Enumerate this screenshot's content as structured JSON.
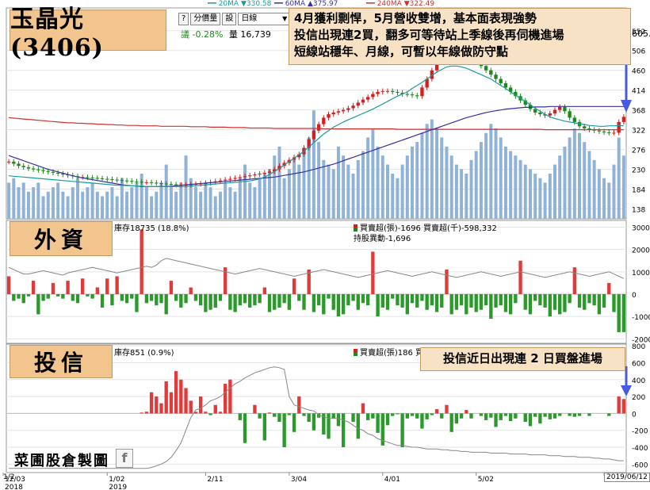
{
  "title": "玉晶光(3406)",
  "toolbar": {
    "analysis_btn": "分價量",
    "settings_btn": "設",
    "period_select": "日線"
  },
  "ma_legend": [
    {
      "label": "20MA",
      "arrow": "▼",
      "value": "330.58",
      "color": "#1a9c9c"
    },
    {
      "label": "60MA",
      "arrow": "▲",
      "value": "375.97",
      "color": "#3b2fa0"
    },
    {
      "label": "240MA",
      "arrow": "▼",
      "value": "322.49",
      "color": "#d03030"
    }
  ],
  "price_info": {
    "fragment": "議",
    "change": "-0.28%",
    "volume_label": "量",
    "volume": "16,739"
  },
  "price_top_label": "605.",
  "note_price": [
    "4月獲利剽悍，5月營收雙增，基本面表現強勢",
    "投信出現連2買，翻多可等待站上季線後再伺機進場",
    "短線站穩年、月線，可暫以年線做防守點"
  ],
  "panel_foreign": {
    "tag": "外資",
    "hold": "庫存18735 (18.8%)",
    "buysell": "買賣超(張)-1696 買賣超(千)-598,332",
    "change": "持股異動-1,696"
  },
  "panel_trust": {
    "tag": "投信",
    "hold": "庫存851 (0.9%)",
    "buysell": "買賣超(張)186 買賣",
    "note": "投信近日出現連 2 日買盤進場"
  },
  "watermark": "菜圃股倉製圖",
  "fb_icon": "facebook-icon",
  "date_labels": [
    {
      "text": "12/03",
      "sub": "2018"
    },
    {
      "text": "1/02",
      "sub": "2019"
    },
    {
      "text": "2/11",
      "sub": ""
    },
    {
      "text": "3/04",
      "sub": ""
    },
    {
      "text": "4/01",
      "sub": ""
    },
    {
      "text": "5/02",
      "sub": ""
    },
    {
      "text": "6/03",
      "sub": ""
    }
  ],
  "date_overlay": "1/2",
  "last_date": "2019/06/12",
  "chart_data": [
    {
      "type": "candlestick",
      "title": "玉晶光(3406)",
      "ylim": [
        115,
        605
      ],
      "y_ticks": [
        138,
        184,
        230,
        276,
        322,
        368,
        414,
        460,
        506,
        552
      ],
      "x_dates": [
        "12/03",
        "1/02",
        "2/11",
        "3/04",
        "4/01",
        "5/02",
        "6/03"
      ],
      "close": [
        248,
        243,
        238,
        235,
        232,
        230,
        228,
        226,
        224,
        222,
        220,
        218,
        216,
        214,
        212,
        212,
        211,
        210,
        209,
        208,
        207,
        206,
        205,
        204,
        203,
        202,
        201,
        200,
        200,
        199,
        198,
        197,
        196,
        195,
        194,
        194,
        194,
        195,
        196,
        197,
        198,
        200,
        202,
        204,
        206,
        208,
        210,
        212,
        214,
        216,
        218,
        220,
        222,
        225,
        230,
        238,
        245,
        252,
        258,
        265,
        280,
        300,
        320,
        335,
        350,
        358,
        362,
        365,
        368,
        372,
        378,
        385,
        392,
        398,
        405,
        410,
        412,
        412,
        410,
        408,
        405,
        404,
        402,
        400,
        420,
        440,
        460,
        480,
        490,
        495,
        500,
        505,
        510,
        500,
        490,
        480,
        470,
        460,
        450,
        440,
        430,
        420,
        410,
        400,
        390,
        380,
        370,
        362,
        358,
        355,
        360,
        368,
        375,
        365,
        350,
        340,
        330,
        325,
        322,
        320,
        318,
        316,
        315,
        315,
        340,
        352
      ],
      "ma20": [
        215,
        214,
        213,
        212,
        211,
        210,
        209,
        208,
        207,
        206,
        205,
        204,
        203,
        202,
        201,
        200,
        199,
        198,
        197,
        196,
        195,
        194,
        193,
        193,
        192,
        192,
        191,
        191,
        190,
        190,
        190,
        190,
        190,
        190,
        190,
        190,
        190,
        191,
        192,
        193,
        194,
        195,
        196,
        197,
        198,
        199,
        200,
        201,
        202,
        203,
        205,
        208,
        212,
        218,
        225,
        232,
        240,
        248,
        256,
        264,
        272,
        282,
        292,
        302,
        312,
        320,
        328,
        334,
        340,
        345,
        350,
        355,
        360,
        365,
        370,
        376,
        382,
        388,
        394,
        400,
        405,
        410,
        418,
        425,
        432,
        440,
        448,
        456,
        462,
        468,
        470,
        470,
        468,
        465,
        460,
        455,
        450,
        445,
        440,
        432,
        425,
        418,
        410,
        402,
        395,
        388,
        380,
        372,
        365,
        358,
        352,
        348,
        345,
        342,
        340,
        338,
        336,
        334,
        332,
        331,
        330,
        330,
        331,
        331,
        332,
        331
      ],
      "ma60": [
        262,
        258,
        254,
        250,
        246,
        242,
        238,
        234,
        230,
        227,
        224,
        221,
        218,
        215,
        212,
        210,
        208,
        206,
        204,
        202,
        200,
        198,
        196,
        194,
        193,
        192,
        191,
        190,
        190,
        190,
        190,
        190,
        190,
        191,
        192,
        193,
        194,
        195,
        196,
        197,
        198,
        199,
        200,
        201,
        202,
        203,
        204,
        205,
        206,
        207,
        208,
        209,
        210,
        211,
        212,
        214,
        216,
        218,
        220,
        222,
        224,
        227,
        230,
        233,
        236,
        239,
        242,
        246,
        250,
        254,
        258,
        262,
        266,
        270,
        274,
        278,
        282,
        286,
        290,
        294,
        298,
        302,
        306,
        310,
        314,
        318,
        322,
        326,
        330,
        334,
        338,
        342,
        346,
        350,
        353,
        356,
        359,
        362,
        364,
        366,
        368,
        370,
        371,
        372,
        373,
        374,
        374,
        375,
        375,
        375,
        376,
        376,
        376,
        376,
        376,
        376,
        376,
        376,
        376,
        376,
        376,
        376,
        376,
        376,
        376,
        376
      ],
      "ma240": [
        350,
        349,
        348,
        347,
        346,
        345,
        344,
        343,
        342,
        341,
        340,
        339,
        338,
        338,
        337,
        337,
        336,
        336,
        335,
        335,
        334,
        334,
        333,
        333,
        332,
        332,
        332,
        331,
        331,
        331,
        331,
        330,
        330,
        330,
        330,
        330,
        330,
        329,
        329,
        329,
        329,
        328,
        328,
        328,
        328,
        327,
        327,
        327,
        327,
        326,
        326,
        326,
        326,
        326,
        325,
        325,
        325,
        325,
        325,
        325,
        325,
        325,
        325,
        325,
        324,
        324,
        324,
        324,
        324,
        324,
        324,
        324,
        324,
        324,
        324,
        324,
        324,
        324,
        324,
        323,
        323,
        323,
        323,
        323,
        323,
        323,
        323,
        323,
        323,
        323,
        323,
        323,
        323,
        323,
        323,
        323,
        323,
        323,
        323,
        323,
        323,
        323,
        323,
        323,
        323,
        323,
        323,
        323,
        323,
        322,
        322,
        322,
        322,
        322,
        322,
        322,
        322,
        322,
        322,
        322,
        322,
        322,
        322,
        322,
        322,
        322
      ],
      "volume": [
        8,
        9,
        7,
        8,
        6,
        7,
        8,
        5,
        6,
        7,
        8,
        6,
        5,
        7,
        9,
        6,
        7,
        8,
        6,
        5,
        6,
        7,
        5,
        9,
        6,
        7,
        8,
        10,
        7,
        5,
        6,
        8,
        12,
        7,
        6,
        8,
        14,
        9,
        7,
        6,
        8,
        7,
        5,
        6,
        8,
        7,
        6,
        9,
        12,
        8,
        7,
        9,
        10,
        11,
        14,
        16,
        9,
        11,
        13,
        12,
        15,
        18,
        24,
        17,
        13,
        12,
        11,
        16,
        14,
        12,
        10,
        13,
        15,
        18,
        20,
        16,
        14,
        12,
        10,
        9,
        12,
        14,
        16,
        17,
        19,
        21,
        22,
        20,
        18,
        16,
        14,
        12,
        11,
        10,
        13,
        15,
        17,
        19,
        21,
        20,
        18,
        16,
        15,
        14,
        13,
        12,
        11,
        10,
        9,
        8,
        10,
        12,
        14,
        16,
        18,
        20,
        19,
        17,
        15,
        13,
        11,
        9,
        8,
        12,
        18,
        14
      ]
    },
    {
      "type": "bar",
      "title": "外資",
      "ylim": [
        -2200,
        3300
      ],
      "y_ticks": [
        -2000,
        -1000,
        0,
        1000,
        2000,
        3000
      ],
      "values": [
        800,
        -300,
        -200,
        -400,
        -100,
        600,
        -900,
        -300,
        -200,
        500,
        -100,
        -200,
        600,
        -300,
        -400,
        700,
        -100,
        -200,
        300,
        -600,
        700,
        -500,
        800,
        -300,
        -400,
        -200,
        -800,
        2900,
        -400,
        -300,
        -500,
        -400,
        -900,
        600,
        -300,
        -600,
        -400,
        300,
        -300,
        -500,
        -800,
        -700,
        -600,
        -300,
        1200,
        -700,
        -800,
        -500,
        -400,
        -600,
        -500,
        -400,
        300,
        -800,
        -700,
        -600,
        -400,
        -700,
        700,
        -300,
        -700,
        1100,
        -800,
        -500,
        -900,
        -200,
        -700,
        -1000,
        -900,
        -500,
        -300,
        -700,
        -400,
        -500,
        1900,
        -1000,
        -600,
        -700,
        -200,
        -500,
        -600,
        -900,
        -400,
        -600,
        -300,
        -700,
        -500,
        -800,
        -600,
        1100,
        -900,
        -700,
        -500,
        -900,
        -600,
        -800,
        -700,
        -500,
        -1100,
        -600,
        -500,
        -800,
        -900,
        -400,
        1500,
        -700,
        -900,
        -300,
        -500,
        -600,
        -1000,
        -700,
        -900,
        -800,
        -400,
        1200,
        -600,
        -700,
        -400,
        -500,
        -900,
        -600,
        500,
        -800,
        -1700,
        -1700
      ],
      "holding_line": [
        1200,
        1100,
        1000,
        900,
        900,
        950,
        1000,
        1050,
        1000,
        950,
        900,
        850,
        950,
        1000,
        1050,
        1100,
        1150,
        1200,
        1150,
        1100,
        1050,
        1000,
        950,
        1000,
        1050,
        1100,
        1150,
        1200,
        1250,
        1200,
        1300,
        1500,
        1600,
        1550,
        1500,
        1450,
        1400,
        1350,
        1300,
        1250,
        1200,
        1150,
        1100,
        1050,
        1000,
        950,
        900,
        950,
        1000,
        1050,
        1100,
        1150,
        1100,
        1050,
        1000,
        950,
        900,
        850,
        800,
        850,
        900,
        950,
        1000,
        1050,
        1100,
        1050,
        1000,
        950,
        900,
        850,
        800,
        750,
        800,
        850,
        900,
        950,
        1000,
        1050,
        1000,
        950,
        900,
        850,
        800,
        850,
        900,
        950,
        1000,
        950,
        900,
        850,
        800,
        750,
        800,
        850,
        900,
        950,
        1000,
        950,
        900,
        850,
        800,
        850,
        900,
        950,
        1000,
        950,
        900,
        850,
        800,
        750,
        800,
        850,
        900,
        950,
        1000,
        950,
        900,
        850,
        800,
        850,
        900,
        950,
        1000,
        900,
        800,
        700
      ]
    },
    {
      "type": "bar",
      "title": "投信",
      "ylim": [
        -700,
        820
      ],
      "y_ticks": [
        -600,
        -400,
        -200,
        0,
        200,
        400,
        600,
        800
      ],
      "values": [
        0,
        0,
        0,
        0,
        0,
        0,
        0,
        0,
        0,
        0,
        0,
        0,
        0,
        0,
        0,
        0,
        0,
        0,
        0,
        0,
        0,
        0,
        0,
        0,
        0,
        0,
        0,
        10,
        20,
        250,
        200,
        120,
        380,
        250,
        500,
        400,
        300,
        150,
        20,
        200,
        20,
        -20,
        100,
        20,
        350,
        400,
        0,
        -80,
        -350,
        0,
        100,
        -60,
        -320,
        10,
        -40,
        -100,
        -400,
        -20,
        -220,
        200,
        -30,
        -100,
        -200,
        -50,
        -250,
        -300,
        -60,
        -150,
        -400,
        0,
        -100,
        -300,
        120,
        -80,
        -60,
        -230,
        -380,
        -140,
        -30,
        -10,
        -400,
        -60,
        -30,
        -60,
        -180,
        -70,
        -20,
        50,
        -60,
        100,
        -220,
        -120,
        -60,
        40,
        -60,
        0,
        -30,
        -80,
        -50,
        -160,
        -80,
        -30,
        -90,
        -60,
        0,
        -100,
        -150,
        -40,
        -120,
        -40,
        -70,
        -60,
        -30,
        0,
        -30,
        -40,
        -30,
        0,
        -30,
        0,
        0,
        0,
        -30,
        0,
        200,
        170
      ],
      "holding_line": [
        -650,
        -650,
        -650,
        -650,
        -650,
        -650,
        -650,
        -650,
        -650,
        -650,
        -650,
        -650,
        -650,
        -650,
        -650,
        -650,
        -650,
        -650,
        -650,
        -650,
        -650,
        -650,
        -650,
        -650,
        -650,
        -650,
        -650,
        -650,
        -650,
        -640,
        -620,
        -600,
        -570,
        -520,
        -440,
        -350,
        -200,
        -50,
        40,
        60,
        100,
        150,
        170,
        200,
        250,
        300,
        350,
        380,
        420,
        450,
        480,
        500,
        520,
        540,
        550,
        540,
        520,
        200,
        100,
        80,
        60,
        40,
        30,
        -20,
        -40,
        -60,
        -60,
        -60,
        -80,
        -100,
        -140,
        -180,
        -200,
        -240,
        -260,
        -300,
        -320,
        -340,
        -360,
        -380,
        -380,
        -390,
        -400,
        -400,
        -410,
        -420,
        -420,
        -420,
        -430,
        -430,
        -440,
        -440,
        -450,
        -450,
        -460,
        -460,
        -460,
        -460,
        -470,
        -470,
        -470,
        -470,
        -480,
        -480,
        -480,
        -480,
        -490,
        -490,
        -490,
        -490,
        -500,
        -500,
        -500,
        -510,
        -510,
        -510,
        -520,
        -520,
        -520,
        -530,
        -530,
        -540,
        -540,
        -550,
        -560,
        -560,
        -560,
        -560,
        -570
      ]
    }
  ]
}
